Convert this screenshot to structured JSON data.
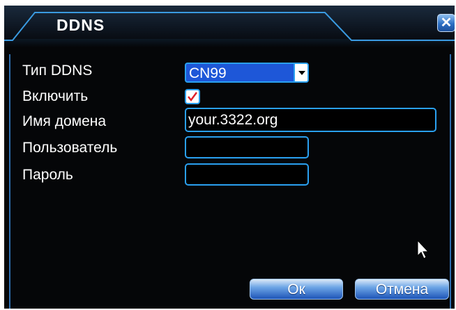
{
  "dialog": {
    "title": "DDNS"
  },
  "fields": {
    "ddns_type": {
      "label": "Тип DDNS",
      "value": "CN99"
    },
    "enable": {
      "label": "Включить",
      "checked": true
    },
    "domain": {
      "label": "Имя домена",
      "value": "your.3322.org"
    },
    "user": {
      "label": "Пользователь",
      "value": ""
    },
    "password": {
      "label": "Пароль",
      "value": ""
    }
  },
  "buttons": {
    "ok": "Ок",
    "cancel": "Отмена"
  },
  "colors": {
    "accent": "#2aa0f0",
    "selection": "#1e57d8",
    "background": "#050608",
    "check": "#e0202a"
  }
}
